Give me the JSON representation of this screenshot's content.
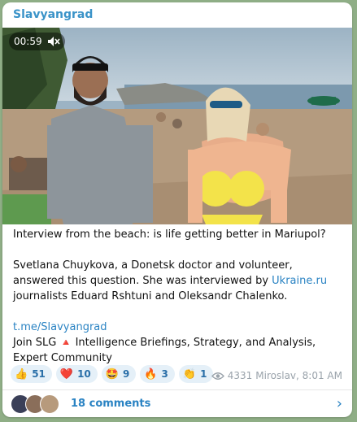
{
  "post": {
    "channel_name": "Slavyangrad",
    "video": {
      "duration": "00:59",
      "muted": true
    },
    "lines": {
      "headline": "Interview from the beach: is life getting better in Mariupol?",
      "p1_before": "Svetlana Chuykova, a Donetsk doctor and volunteer, answered this question. She was interviewed by ",
      "p1_link": "Ukraine.ru",
      "p1_after": " journalists Eduard Rshtuni and Oleksandr Chalenko.",
      "channel_link": "t.me/Slavyangrad",
      "join_before": "Join SLG ",
      "join_flag": "🔺",
      "join_after": " Intelligence Briefings, Strategy, and Analysis, Expert Community"
    },
    "reactions": [
      {
        "emoji": "👍",
        "count": "51"
      },
      {
        "emoji": "❤️",
        "count": "10"
      },
      {
        "emoji": "🤩",
        "count": "9"
      },
      {
        "emoji": "🔥",
        "count": "3"
      },
      {
        "emoji": "👏",
        "count": "1"
      }
    ],
    "views": "4331",
    "author_time": "Miroslav, 8:01 AM",
    "comments_label": "18 comments"
  },
  "colors": {
    "accent": "#3a93c8",
    "reaction_bg": "#e5f0f8",
    "chat_background": "#8fae86"
  }
}
